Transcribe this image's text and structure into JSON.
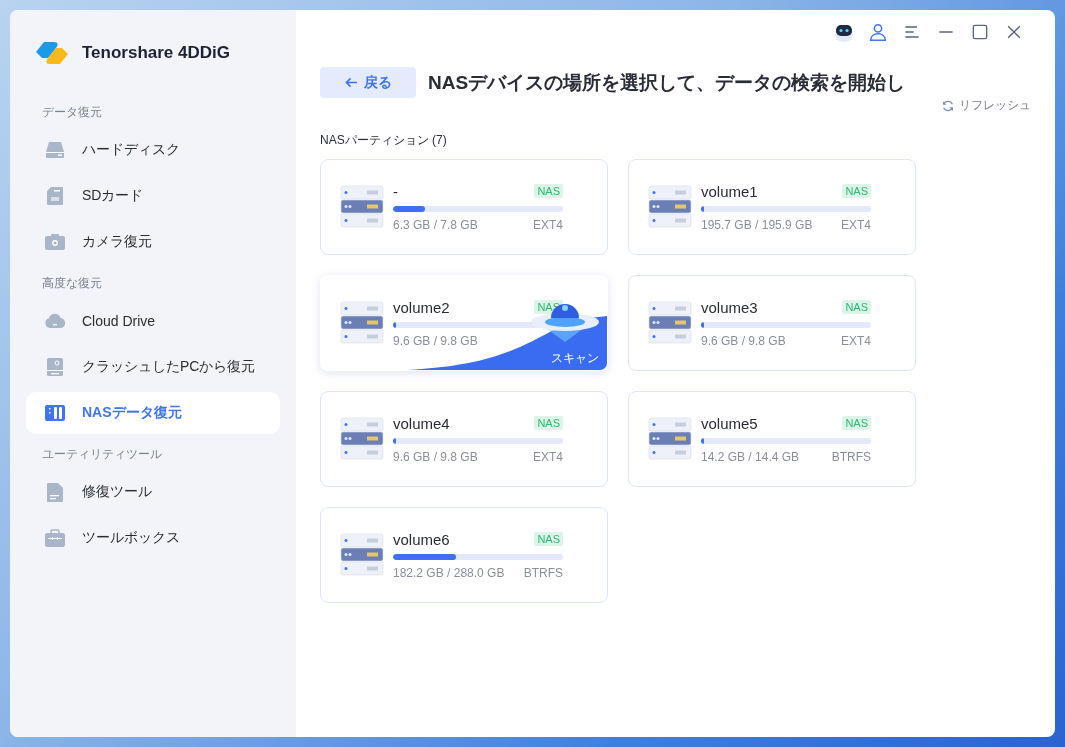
{
  "sidebar": {
    "logo": "Tenorshare 4DDiG",
    "sections": [
      {
        "label": "データ復元",
        "items": [
          {
            "label": "ハードディスク",
            "selected": false
          },
          {
            "label": "SDカード",
            "selected": false
          },
          {
            "label": "カメラ復元",
            "selected": false
          }
        ]
      },
      {
        "label": "高度な復元",
        "items": [
          {
            "label": "Cloud Drive",
            "selected": false
          },
          {
            "label": "クラッシュしたPCから復元",
            "selected": false
          },
          {
            "label": "NASデータ復元",
            "selected": true
          }
        ]
      },
      {
        "label": "ユーティリティツール",
        "items": [
          {
            "label": "修復ツール",
            "selected": false
          },
          {
            "label": "ツールボックス",
            "selected": false
          }
        ]
      }
    ]
  },
  "header": {
    "back_button": "戻る",
    "title": "NASデバイスの場所を選択して、データの検索を開始し",
    "refresh": "リフレッシュ"
  },
  "partitions": {
    "heading": "NASパーティション (7)",
    "items": [
      {
        "name": "-",
        "tag": "NAS",
        "level": 0.19,
        "usage": "6.3 GB / 7.8 GB",
        "fs": "EXT4",
        "hovered": false
      },
      {
        "name": "volume1",
        "tag": "NAS",
        "level": 0.002,
        "usage": "195.7 GB / 195.9 GB",
        "fs": "EXT4",
        "hovered": false
      },
      {
        "name": "volume2",
        "tag": "NAS",
        "level": 0.02,
        "usage": "9.6 GB / 9.8 GB",
        "hovered": true,
        "scan": "スキャン"
      },
      {
        "name": "volume3",
        "tag": "NAS",
        "level": 0.02,
        "usage": "9.6 GB / 9.8 GB",
        "fs": "EXT4",
        "hovered": false
      },
      {
        "name": "volume4",
        "tag": "NAS",
        "level": 0.02,
        "usage": "9.6 GB / 9.8 GB",
        "fs": "EXT4",
        "hovered": false
      },
      {
        "name": "volume5",
        "tag": "NAS",
        "level": 0.014,
        "usage": "14.2 GB / 14.4 GB",
        "fs": "BTRFS",
        "hovered": false
      },
      {
        "name": "volume6",
        "tag": "NAS",
        "level": 0.37,
        "usage": "182.2 GB / 288.0 GB",
        "fs": "BTRFS",
        "hovered": false
      }
    ]
  }
}
